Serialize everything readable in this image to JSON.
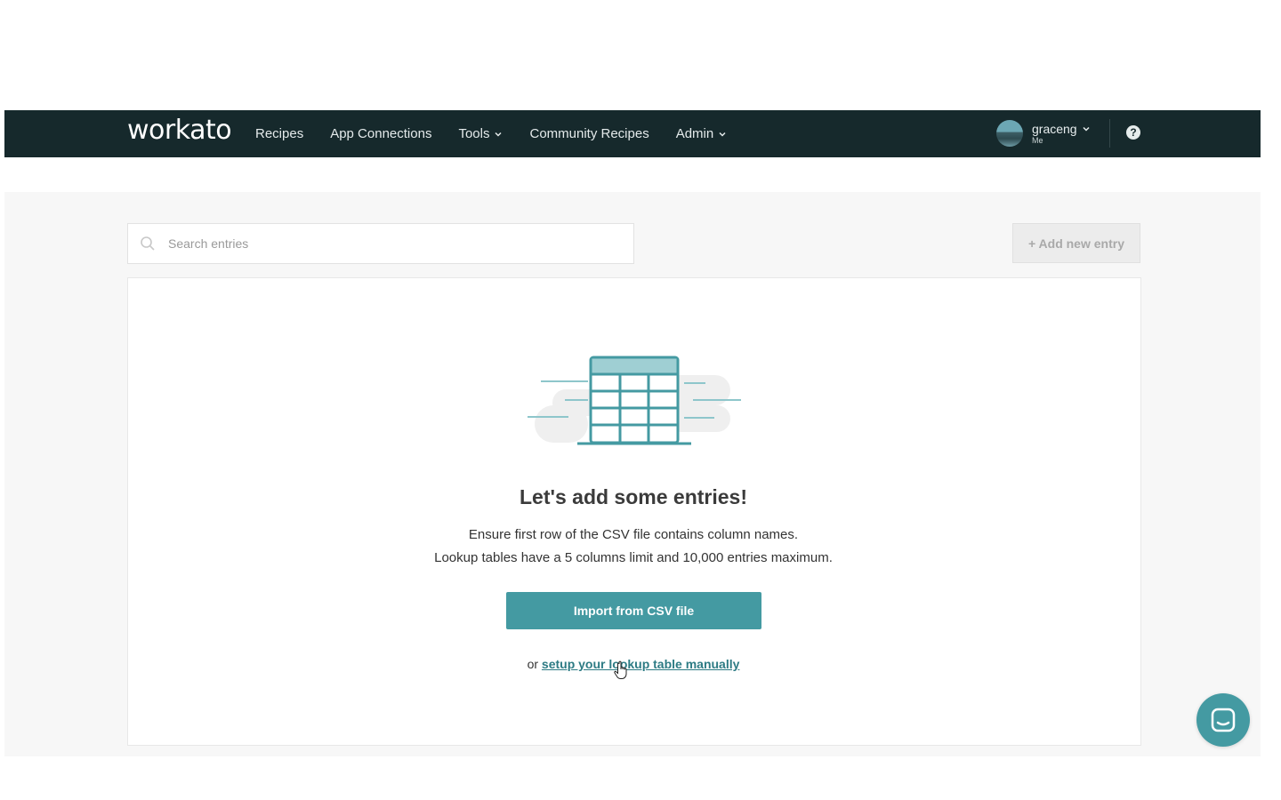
{
  "nav": {
    "logo": "workato",
    "links": [
      {
        "label": "Recipes"
      },
      {
        "label": "App Connections"
      },
      {
        "label": "Tools"
      },
      {
        "label": "Community Recipes"
      },
      {
        "label": "Admin"
      }
    ],
    "user": {
      "name": "graceng",
      "sub": "Me"
    },
    "help_icon": "question-circle-icon"
  },
  "toolbar": {
    "search_placeholder": "Search entries",
    "add_label": "+ Add new entry"
  },
  "empty_state": {
    "heading": "Let's add some entries!",
    "line1": "Ensure first row of the CSV file contains column names.",
    "line2": "Lookup tables have a 5 columns limit and 10,000 entries maximum.",
    "import_label": "Import from CSV file",
    "or_text": "or",
    "manual_link": "setup your lookup table manually"
  },
  "colors": {
    "nav_bg": "#16292c",
    "accent": "#449aa2"
  }
}
